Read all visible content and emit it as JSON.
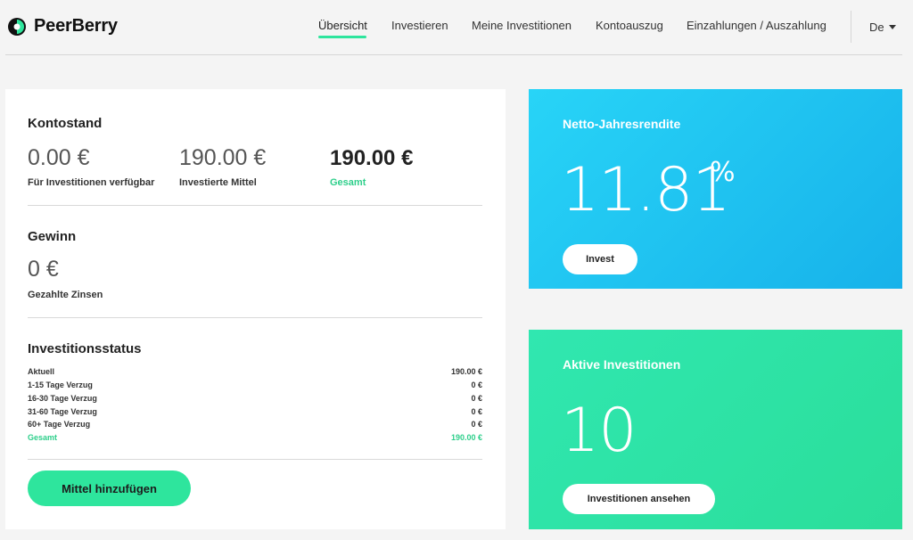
{
  "header": {
    "logo_text": "PeerBerry",
    "nav": [
      "Übersicht",
      "Investieren",
      "Meine Investitionen",
      "Kontoauszug",
      "Einzahlungen / Auszahlung"
    ],
    "active_nav": "Übersicht",
    "language": "De",
    "accent": "#2ee59d"
  },
  "balance": {
    "title": "Kontostand",
    "available_value": "0.00 €",
    "available_label": "Für Investitionen verfügbar",
    "invested_value": "190.00 €",
    "invested_label": "Investierte Mittel",
    "total_value": "190.00 €",
    "total_label": "Gesamt"
  },
  "profit": {
    "title": "Gewinn",
    "value": "0 €",
    "label": "Gezahlte Zinsen"
  },
  "status": {
    "title": "Investitionsstatus",
    "rows": [
      {
        "label": "Aktuell",
        "value": "190.00 €"
      },
      {
        "label": "1-15 Tage Verzug",
        "value": "0 €"
      },
      {
        "label": "16-30 Tage Verzug",
        "value": "0 €"
      },
      {
        "label": "31-60 Tage Verzug",
        "value": "0 €"
      },
      {
        "label": "60+ Tage Verzug",
        "value": "0 €"
      },
      {
        "label": "Gesamt",
        "value": "190.00 €"
      }
    ],
    "add_button": "Mittel hinzufügen"
  },
  "return_panel": {
    "title": "Netto-Jahresrendite",
    "value": "11.81",
    "unit": "%",
    "button": "Invest",
    "color": "#1fc3f0"
  },
  "active_panel": {
    "title": "Aktive Investitionen",
    "value": "10",
    "button": "Investitionen ansehen",
    "color": "#2ee4a5"
  }
}
